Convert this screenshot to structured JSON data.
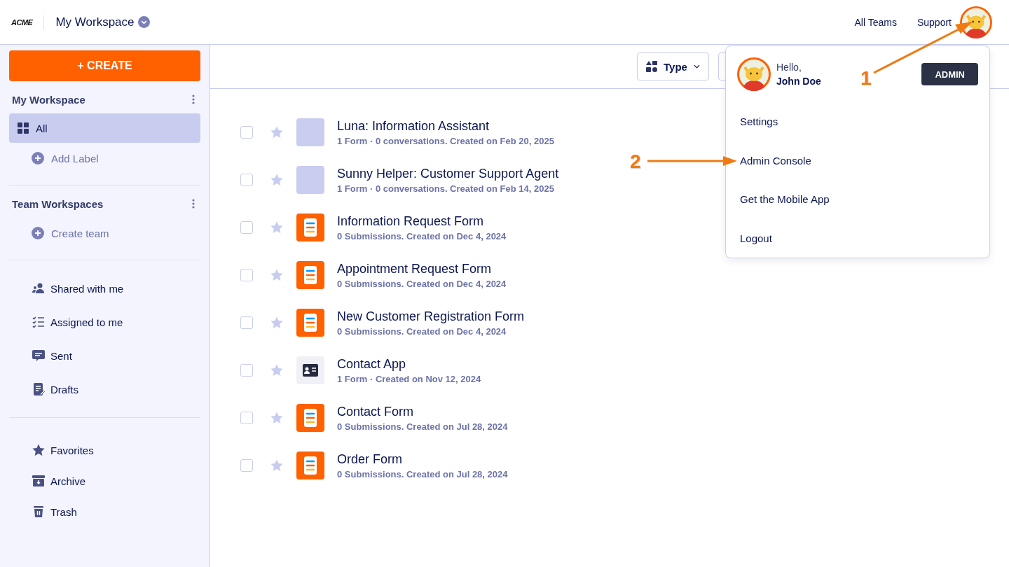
{
  "header": {
    "logo": "ACME",
    "workspace": "My Workspace",
    "links": [
      "All Teams",
      "Support"
    ]
  },
  "create_button": "+ CREATE",
  "sidebar": {
    "sections": [
      {
        "title": "My Workspace",
        "items": [
          {
            "label": "All",
            "kind": "nav",
            "selected": true
          },
          {
            "label": "Add Label",
            "kind": "add",
            "selected": false
          }
        ]
      },
      {
        "title": "Team Workspaces",
        "items": [
          {
            "label": "Create team",
            "kind": "add",
            "selected": false
          }
        ]
      }
    ],
    "nav_groups": [
      [
        {
          "label": "Shared with me",
          "selected": false
        },
        {
          "label": "Assigned to me",
          "selected": false
        },
        {
          "label": "Sent",
          "selected": false
        },
        {
          "label": "Drafts",
          "selected": false
        }
      ],
      [
        {
          "label": "Favorites",
          "selected": false
        },
        {
          "label": "Archive",
          "selected": false
        },
        {
          "label": "Trash",
          "selected": false
        }
      ]
    ]
  },
  "toolbar": {
    "type_filter": "Type"
  },
  "items": [
    {
      "title": "Luna: Information Assistant",
      "meta": "1 Form · 0 conversations. Created on Feb 20, 2025",
      "kind": "agent",
      "checked": false,
      "starred": false
    },
    {
      "title": "Sunny Helper: Customer Support Agent",
      "meta": "1 Form · 0 conversations. Created on Feb 14, 2025",
      "kind": "agent",
      "checked": false,
      "starred": false
    },
    {
      "title": "Information Request Form",
      "meta": "0 Submissions. Created on Dec 4, 2024",
      "kind": "form",
      "checked": false,
      "starred": false
    },
    {
      "title": "Appointment Request Form",
      "meta": "0 Submissions. Created on Dec 4, 2024",
      "kind": "form",
      "checked": false,
      "starred": false
    },
    {
      "title": "New Customer Registration Form",
      "meta": "0 Submissions. Created on Dec 4, 2024",
      "kind": "form",
      "checked": false,
      "starred": false
    },
    {
      "title": "Contact App",
      "meta": "1 Form · Created on Nov 12, 2024",
      "kind": "app",
      "checked": false,
      "starred": false
    },
    {
      "title": "Contact Form",
      "meta": "0 Submissions. Created on Jul 28, 2024",
      "kind": "form",
      "checked": false,
      "starred": false
    },
    {
      "title": "Order Form",
      "meta": "0 Submissions. Created on Jul 28, 2024",
      "kind": "form",
      "checked": false,
      "starred": false
    }
  ],
  "user_menu": {
    "greeting": "Hello,",
    "name": "John Doe",
    "role": "ADMIN",
    "items": [
      "Settings",
      "Admin Console",
      "Get the Mobile App",
      "Logout"
    ]
  },
  "annotations": [
    {
      "label": "1"
    },
    {
      "label": "2"
    }
  ]
}
